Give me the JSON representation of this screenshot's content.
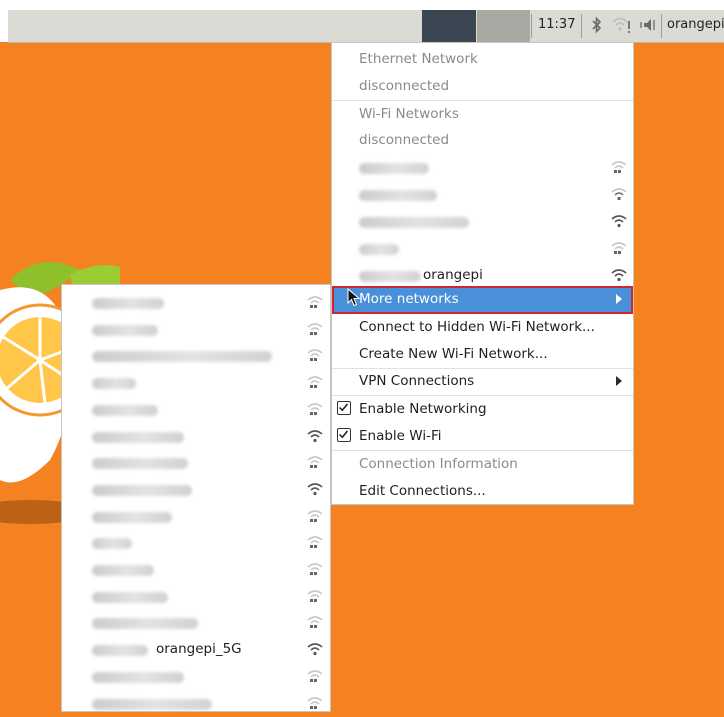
{
  "panel": {
    "clock": "11:37",
    "hostname": "orangepi",
    "icons": [
      "bluetooth-icon",
      "wifi-disconnected-icon",
      "volume-icon"
    ]
  },
  "network_menu": {
    "ethernet_header": "Ethernet Network",
    "ethernet_status": "disconnected",
    "wifi_header": "Wi-Fi Networks",
    "wifi_status": "disconnected",
    "wifi_networks": [
      {
        "name": "",
        "signal": "weak"
      },
      {
        "name": "",
        "signal": "weak"
      },
      {
        "name": "",
        "signal": "strong"
      },
      {
        "name": "",
        "signal": "weak"
      },
      {
        "name": "orangepi",
        "signal": "strong"
      }
    ],
    "more_networks": "More networks",
    "connect_hidden": "Connect to Hidden Wi-Fi Network...",
    "create_new": "Create New Wi-Fi Network...",
    "vpn": "VPN Connections",
    "enable_networking": "Enable Networking",
    "enable_wifi": "Enable Wi-Fi",
    "connection_info": "Connection Information",
    "edit_connections": "Edit Connections..."
  },
  "submenu": {
    "networks": [
      {
        "name": "",
        "signal": "weak"
      },
      {
        "name": "",
        "signal": "weak"
      },
      {
        "name": "",
        "signal": "weak"
      },
      {
        "name": "",
        "signal": "weak"
      },
      {
        "name": "",
        "signal": "weak"
      },
      {
        "name": "",
        "signal": "strong"
      },
      {
        "name": "",
        "signal": "weak"
      },
      {
        "name": "",
        "signal": "strong"
      },
      {
        "name": "",
        "signal": "weak"
      },
      {
        "name": "",
        "signal": "weak"
      },
      {
        "name": "",
        "signal": "weak"
      },
      {
        "name": "",
        "signal": "weak"
      },
      {
        "name": "",
        "signal": "weak"
      },
      {
        "name": "orangepi_5G",
        "signal": "strong"
      },
      {
        "name": "",
        "signal": "weak"
      },
      {
        "name": "",
        "signal": "weak"
      }
    ]
  },
  "colors": {
    "desktop": "#f58220",
    "highlight": "#4a90d9",
    "highlight_outline": "#d0262f"
  }
}
